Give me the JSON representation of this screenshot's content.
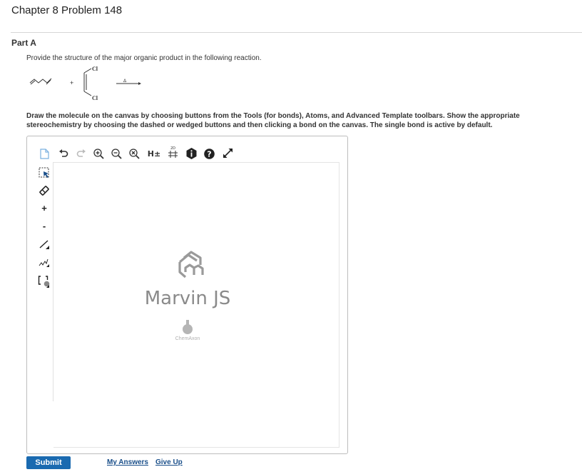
{
  "header": {
    "title": "Chapter 8 Problem 148"
  },
  "part": {
    "label": "Part A"
  },
  "question": {
    "text": "Provide the structure of the major organic product in the following reaction.",
    "reaction": {
      "plus": "+",
      "atom_top": "Cl",
      "atom_bottom": "Cl",
      "heat": "Δ"
    }
  },
  "instructions": "Draw the molecule on the canvas by choosing buttons from the Tools (for bonds), Atoms, and Advanced Template toolbars. Show the appropriate stereochemistry by choosing the dashed or wedged buttons and then clicking a bond on the canvas. The single bond is active by default.",
  "editor": {
    "toolbar": {
      "hydrogen_label": "H±",
      "icons": [
        "new-document-icon",
        "undo-icon",
        "redo-icon",
        "zoom-in-icon",
        "zoom-out-icon",
        "clean-icon",
        "hydrogen-toggle",
        "2d-clean-icon",
        "info-icon",
        "help-icon",
        "fullscreen-icon"
      ]
    },
    "left_tools": {
      "plus_label": "+",
      "minus_label": "-",
      "icons": [
        "select-icon",
        "eraser-icon",
        "charge-plus",
        "charge-minus",
        "single-bond-icon",
        "chain-icon",
        "bracket-icon"
      ]
    },
    "watermark": {
      "title": "Marvin JS",
      "company": "ChemAxon"
    }
  },
  "actions": {
    "submit_label": "Submit",
    "my_answers_label": "My Answers",
    "give_up_label": "Give Up"
  },
  "colors": {
    "submit_bg": "#1a6ab0",
    "link": "#1a4f8a"
  }
}
